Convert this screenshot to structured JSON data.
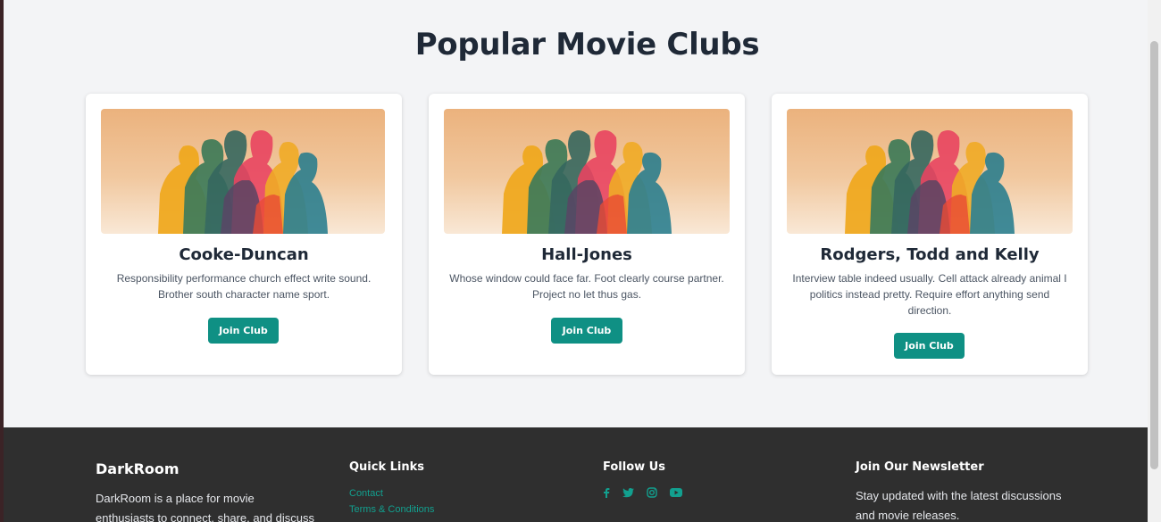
{
  "section": {
    "title": "Popular Movie Clubs"
  },
  "clubs": [
    {
      "name": "Cooke-Duncan",
      "desc_lines": [
        "Responsibility performance church effect write sound.",
        "Brother south character name sport."
      ],
      "button": "Join Club"
    },
    {
      "name": "Hall-Jones",
      "desc_lines": [
        "Whose window could face far. Foot clearly course partner.",
        "Project no let thus gas."
      ],
      "button": "Join Club"
    },
    {
      "name": "Rodgers, Todd and Kelly",
      "desc_lines": [
        "Interview table indeed usually. Cell attack already animal I",
        "politics instead pretty. Require effort anything send",
        "direction."
      ],
      "button": "Join Club"
    }
  ],
  "footer": {
    "brand": "DarkRoom",
    "about_lines": [
      "DarkRoom is a place for movie",
      "enthusiasts to connect, share, and discuss"
    ],
    "quick_links": {
      "heading": "Quick Links",
      "items": [
        "Contact",
        "Terms & Conditions"
      ]
    },
    "follow": {
      "heading": "Follow Us",
      "icons": [
        "facebook-icon",
        "twitter-icon",
        "instagram-icon",
        "youtube-icon"
      ]
    },
    "newsletter": {
      "heading": "Join Our Newsletter",
      "lines": [
        "Stay updated with the latest discussions",
        "and movie releases."
      ]
    }
  },
  "colors": {
    "accent": "#0f9084",
    "link": "#12a08f",
    "footer_bg": "#2f2f2f",
    "page_bg": "#f3f4f6"
  }
}
